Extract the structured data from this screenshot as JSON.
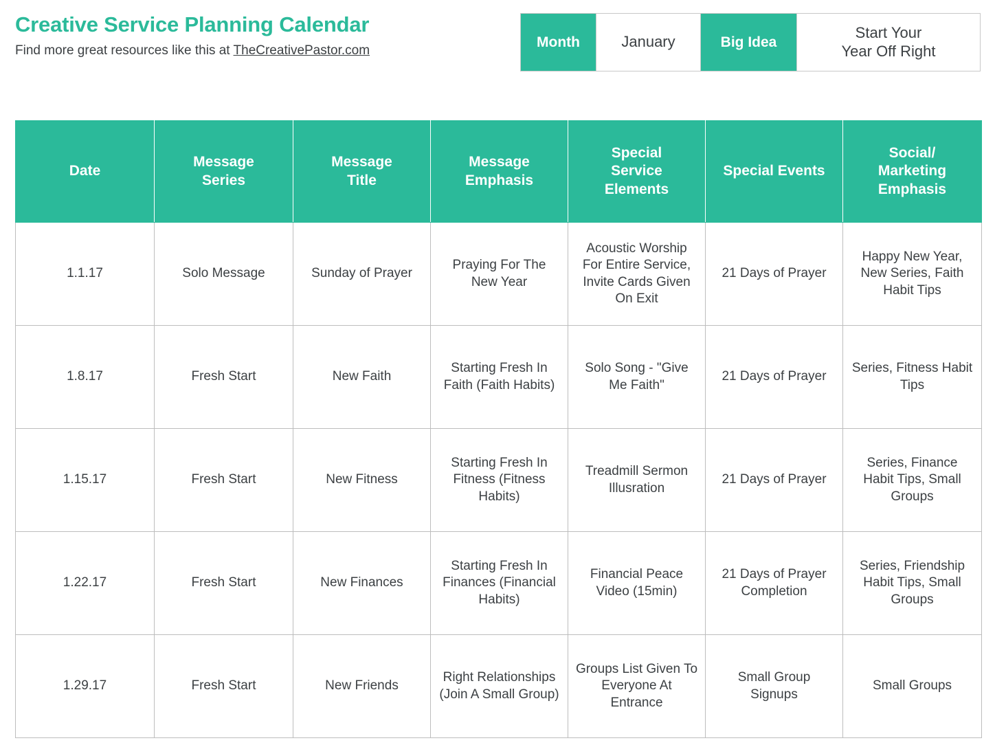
{
  "brand": {
    "title": "Creative Service Planning Calendar",
    "subtitle_prefix": "Find more great resources like this at ",
    "link_text": "TheCreativePastor.com"
  },
  "info_strip": {
    "month_label": "Month",
    "month_value": "January",
    "big_idea_label": "Big Idea",
    "big_idea_value": "Start Your\nYear Off Right",
    "big_idea_value_line1": "Start Your",
    "big_idea_value_line2": "Year Off Right"
  },
  "colors": {
    "accent_teal": "#2BBA9A",
    "text_dark": "#3c4043",
    "border_gray": "#bdbdbd",
    "background": "#ffffff"
  },
  "table": {
    "columns": [
      {
        "key": "date",
        "label": "Date"
      },
      {
        "key": "series",
        "label": "Message\nSeries",
        "line1": "Message",
        "line2": "Series"
      },
      {
        "key": "title",
        "label": "Message\nTitle",
        "line1": "Message",
        "line2": "Title"
      },
      {
        "key": "emph",
        "label": "Message\nEmphasis",
        "line1": "Message",
        "line2": "Emphasis"
      },
      {
        "key": "special",
        "label": "Special\nService\nElements",
        "line1": "Special",
        "line2": "Service",
        "line3": "Elements"
      },
      {
        "key": "events",
        "label": "Special Events"
      },
      {
        "key": "social",
        "label": "Social/\nMarketing\nEmphasis",
        "line1": "Social/",
        "line2": "Marketing",
        "line3": "Emphasis"
      }
    ],
    "rows": [
      {
        "date": "1.1.17",
        "series": "Solo Message",
        "title": "Sunday of Prayer",
        "emph": "Praying For The New Year",
        "special": "Acoustic Worship For Entire Service, Invite Cards Given On Exit",
        "events": "21 Days of Prayer",
        "social": "Happy New Year, New Series, Faith Habit Tips"
      },
      {
        "date": "1.8.17",
        "series": "Fresh Start",
        "title": "New Faith",
        "emph": "Starting Fresh In Faith (Faith Habits)",
        "special": "Solo Song - \"Give Me Faith\"",
        "events": "21 Days of Prayer",
        "social": "Series, Fitness Habit Tips"
      },
      {
        "date": "1.15.17",
        "series": "Fresh Start",
        "title": "New Fitness",
        "emph": "Starting Fresh In Fitness (Fitness Habits)",
        "special": "Treadmill Sermon Illusration",
        "events": "21 Days of Prayer",
        "social": "Series, Finance Habit Tips, Small Groups"
      },
      {
        "date": "1.22.17",
        "series": "Fresh Start",
        "title": "New Finances",
        "emph": "Starting Fresh In Finances (Financial Habits)",
        "special": "Financial Peace Video (15min)",
        "events": "21 Days of Prayer Completion",
        "social": "Series, Friendship Habit Tips, Small Groups"
      },
      {
        "date": "1.29.17",
        "series": "Fresh Start",
        "title": "New Friends",
        "emph": "Right Relationships (Join A Small Group)",
        "special": "Groups List Given To Everyone At Entrance",
        "events": "Small Group Signups",
        "social": "Small Groups"
      }
    ]
  }
}
